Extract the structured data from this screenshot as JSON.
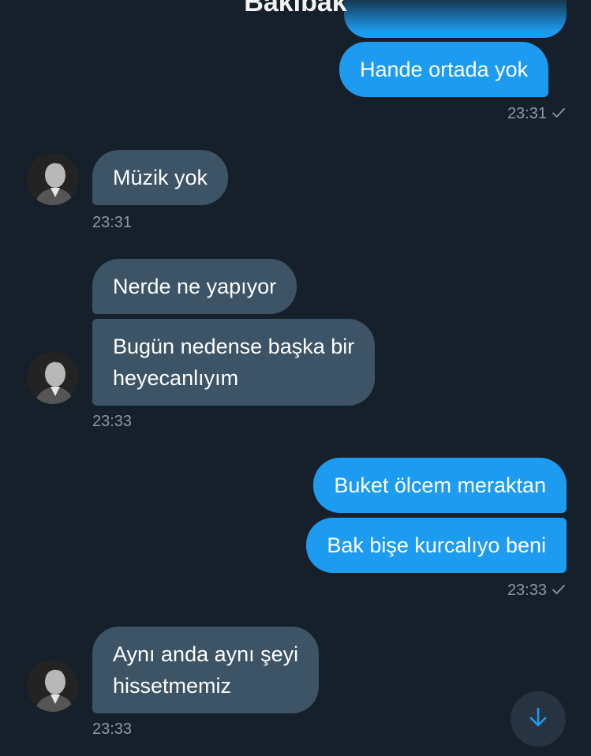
{
  "header": {
    "title": "Bakibak"
  },
  "colors": {
    "background": "#15202b",
    "outgoing_bubble": "#1d9bf0",
    "incoming_bubble": "#3d5466",
    "timestamp": "#8b98a5",
    "scroll_button": "#273340"
  },
  "messages": [
    {
      "direction": "outgoing",
      "text": "Hande ortada yok"
    },
    {
      "direction": "incoming",
      "text": "Müzik yok"
    },
    {
      "direction": "incoming",
      "text": "Nerde ne yapıyor"
    },
    {
      "direction": "incoming",
      "lines": [
        "Bugün nedense başka bir",
        "heyecanlıyım"
      ]
    },
    {
      "direction": "outgoing",
      "text": "Buket ölcem meraktan"
    },
    {
      "direction": "outgoing",
      "text": "Bak bişe kurcalıyo beni"
    },
    {
      "direction": "incoming",
      "lines": [
        "Aynı anda aynı şeyi",
        "hissetmemiz"
      ]
    }
  ],
  "timestamps": {
    "group1": "23:31",
    "group2": "23:31",
    "group3": "23:33",
    "group4": "23:33",
    "group5": "23:33"
  },
  "icons": {
    "sent_check": "check-icon",
    "scroll_down": "arrow-down-icon",
    "avatar": "avatar-photo"
  }
}
